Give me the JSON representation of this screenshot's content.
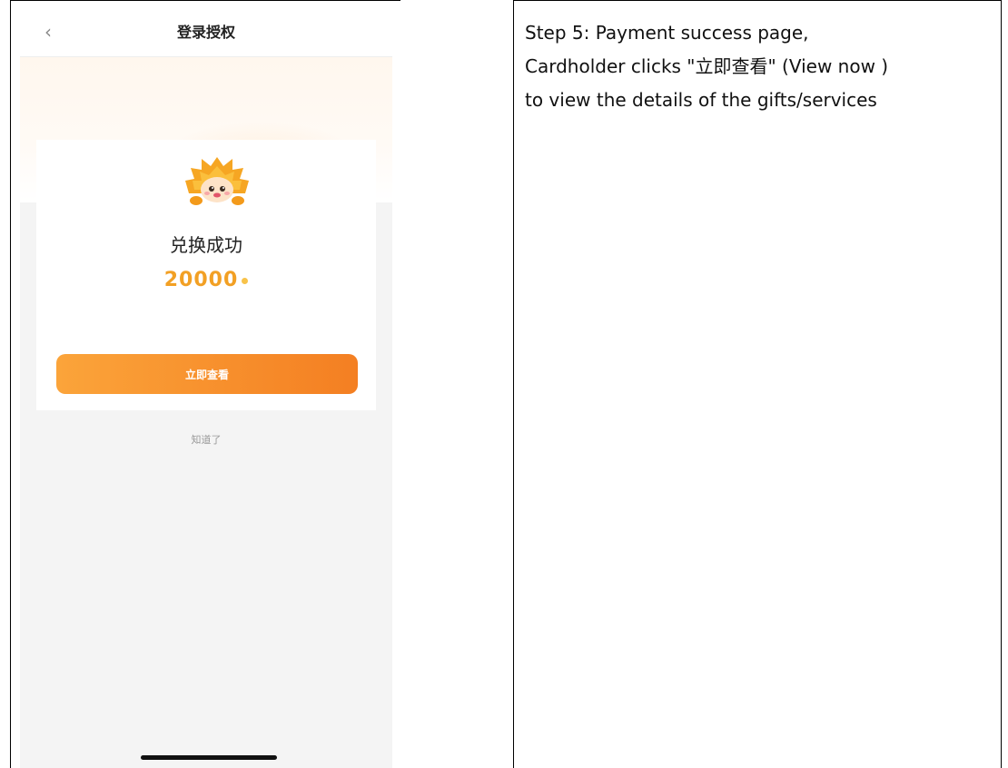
{
  "phone": {
    "header_title": "登录授权",
    "back_icon": "chevron-left-icon",
    "success_text": "兑换成功",
    "points_value": "20000",
    "view_button_label": "立即查看",
    "got_it_label": "知道了",
    "accent_color": "#f47f22"
  },
  "description": {
    "lines": [
      "Step 5: Payment success page,",
      "Cardholder clicks \"立即查看\"  (View now )",
      "to view the details of the gifts/services"
    ]
  }
}
